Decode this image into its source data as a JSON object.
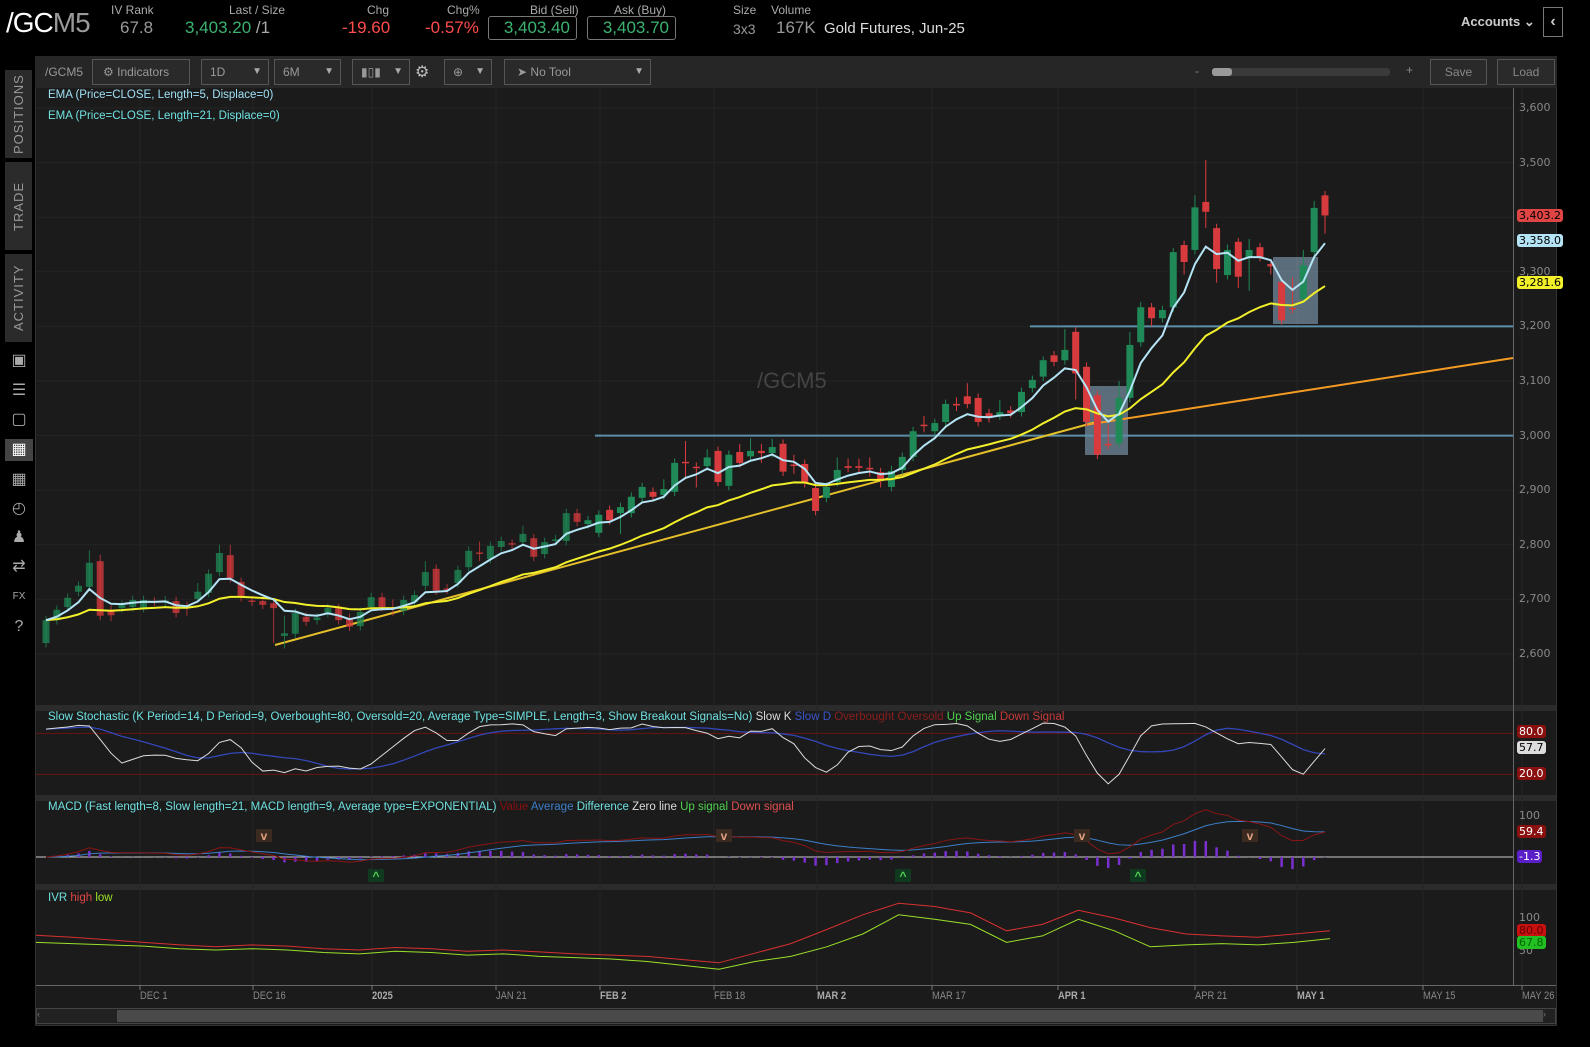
{
  "header": {
    "symbol_main": "/GC",
    "symbol_suffix": "M5",
    "iv_rank_label": "IV Rank",
    "iv_rank": "67.8",
    "last_label": "Last / Size",
    "last": "3,403.20",
    "size": "/1",
    "chg_label": "Chg",
    "chg": "-19.60",
    "chgp_label": "Chg%",
    "chgp": "-0.57%",
    "bid_label": "Bid (Sell)",
    "bid": "3,403.40",
    "ask_label": "Ask (Buy)",
    "ask": "3,403.70",
    "sz_label": "Size",
    "sz": "3x3",
    "vol_label": "Volume",
    "vol": "167K",
    "desc": "Gold Futures, Jun-25",
    "accounts": "Accounts"
  },
  "sidebar": {
    "tabs": [
      "POSITIONS",
      "TRADE",
      "ACTIVITY"
    ],
    "icons": [
      "chart-book-icon",
      "list-icon",
      "tv-icon",
      "chart-grid-icon",
      "layout-icon",
      "history-icon",
      "community-icon",
      "exchange-icon",
      "fx-icon",
      "help-icon"
    ]
  },
  "toolbar": {
    "symbol": "/GCM5",
    "indicators": "Indicators",
    "aggregation": "1D",
    "period": "6M",
    "drawing_tool": "No Tool",
    "zoom_minus": "-",
    "zoom_plus": "+",
    "zoom_level": 0.1,
    "save": "Save",
    "load": "Load"
  },
  "colors": {
    "up": "#1f8a57",
    "down": "#d83b3e",
    "ema5": "#b4e4f5",
    "ema21": "#f2f02a",
    "support": "#5d8fa8",
    "trendline_yellow": "#e6c02a",
    "trendline_orange": "#f59a23",
    "highlight": "#8fb0c8",
    "accent_red": "#ff4d4d",
    "accent_green": "#3cb371"
  },
  "main": {
    "watermark": "/GCM5",
    "studies": [
      "EMA (Price=CLOSE, Length=5, Displace=0)",
      "EMA (Price=CLOSE, Length=21, Displace=0)"
    ],
    "price_labels": [
      "3,600",
      "3,500",
      "3,400",
      "3,300",
      "3,200",
      "3,100",
      "3,000",
      "2,900",
      "2,800",
      "2,700",
      "2,600"
    ],
    "tag_last": "3,403.2",
    "tag_ema5": "3,358.0",
    "tag_ema21": "3,281.6"
  },
  "stoch": {
    "title": "Slow Stochastic (K Period=14, D Period=9, Overbought=80, Oversold=20, Average Type=SIMPLE, Length=3, Show Breakout Signals=No)",
    "legend": [
      "Slow K",
      "Slow D",
      "Overbought",
      "Oversold",
      "Up Signal",
      "Down Signal"
    ],
    "tag_ob": "80.0",
    "tag_k": "57.7",
    "tag_os": "20.0"
  },
  "macd": {
    "title": "MACD (Fast length=8, Slow length=21, MACD length=9, Average type=EXPONENTIAL)",
    "legend": [
      "Value",
      "Average",
      "Difference",
      "Zero line",
      "Up signal",
      "Down signal"
    ],
    "axis": "100",
    "tag_value": "59.4",
    "tag_diff": "-1.3"
  },
  "ivr": {
    "title": "IVR",
    "legend": [
      "high",
      "low"
    ],
    "axis_top": "100",
    "axis_bottom": "50",
    "tag_high": "80.0",
    "tag_low": "67.8"
  },
  "xaxis": [
    "DEC 1",
    "DEC 16",
    "2025",
    "JAN 21",
    "FEB 2",
    "FEB 18",
    "MAR 2",
    "MAR 17",
    "APR 1",
    "APR 21",
    "MAY 1",
    "MAY 15",
    "MAY 26"
  ],
  "chart_data": {
    "type": "candlestick",
    "symbol": "/GCM5",
    "ylim": [
      2550,
      3650
    ],
    "yticks": [
      2600,
      2700,
      2800,
      2900,
      3000,
      3100,
      3200,
      3300,
      3400,
      3500,
      3600
    ],
    "horizontal_levels": [
      3000,
      3200
    ],
    "ohlc": [
      [
        2620,
        2670,
        2612,
        2662
      ],
      [
        2662,
        2689,
        2654,
        2681
      ],
      [
        2686,
        2711,
        2678,
        2703
      ],
      [
        2714,
        2733,
        2706,
        2725
      ],
      [
        2723,
        2790,
        2715,
        2767
      ],
      [
        2770,
        2782,
        2662,
        2670
      ],
      [
        2681,
        2689,
        2660,
        2671
      ],
      [
        2684,
        2698,
        2676,
        2690
      ],
      [
        2686,
        2707,
        2678,
        2699
      ],
      [
        2684,
        2707,
        2676,
        2699
      ],
      [
        2697,
        2704,
        2688,
        2695
      ],
      [
        2694,
        2706,
        2686,
        2698
      ],
      [
        2697,
        2705,
        2667,
        2675
      ],
      [
        2688,
        2696,
        2670,
        2684
      ],
      [
        2701,
        2730,
        2693,
        2714
      ],
      [
        2712,
        2755,
        2704,
        2747
      ],
      [
        2750,
        2800,
        2742,
        2785
      ],
      [
        2781,
        2800,
        2731,
        2739
      ],
      [
        2732,
        2740,
        2696,
        2704
      ],
      [
        2698,
        2706,
        2688,
        2696
      ],
      [
        2697,
        2705,
        2682,
        2690
      ],
      [
        2693,
        2701,
        2620,
        2684
      ],
      [
        2633,
        2670,
        2610,
        2638
      ],
      [
        2637,
        2683,
        2629,
        2675
      ],
      [
        2668,
        2676,
        2651,
        2659
      ],
      [
        2662,
        2675,
        2654,
        2667
      ],
      [
        2675,
        2692,
        2667,
        2684
      ],
      [
        2684,
        2692,
        2654,
        2662
      ],
      [
        2666,
        2674,
        2642,
        2650
      ],
      [
        2651,
        2685,
        2643,
        2677
      ],
      [
        2686,
        2712,
        2678,
        2704
      ],
      [
        2704,
        2712,
        2678,
        2686
      ],
      [
        2685,
        2700,
        2670,
        2684
      ],
      [
        2679,
        2707,
        2671,
        2699
      ],
      [
        2695,
        2716,
        2687,
        2708
      ],
      [
        2725,
        2770,
        2717,
        2750
      ],
      [
        2756,
        2764,
        2708,
        2716
      ],
      [
        2720,
        2728,
        2710,
        2718
      ],
      [
        2730,
        2762,
        2722,
        2754
      ],
      [
        2759,
        2797,
        2751,
        2789
      ],
      [
        2786,
        2806,
        2770,
        2785
      ],
      [
        2774,
        2806,
        2766,
        2798
      ],
      [
        2796,
        2815,
        2788,
        2807
      ],
      [
        2803,
        2810,
        2790,
        2802
      ],
      [
        2805,
        2835,
        2797,
        2820
      ],
      [
        2812,
        2820,
        2770,
        2778
      ],
      [
        2783,
        2813,
        2775,
        2805
      ],
      [
        2807,
        2818,
        2799,
        2810
      ],
      [
        2807,
        2866,
        2799,
        2858
      ],
      [
        2858,
        2866,
        2834,
        2842
      ],
      [
        2838,
        2853,
        2830,
        2845
      ],
      [
        2822,
        2863,
        2814,
        2855
      ],
      [
        2864,
        2872,
        2837,
        2845
      ],
      [
        2858,
        2877,
        2820,
        2869
      ],
      [
        2858,
        2896,
        2850,
        2888
      ],
      [
        2886,
        2914,
        2878,
        2906
      ],
      [
        2897,
        2905,
        2880,
        2888
      ],
      [
        2891,
        2920,
        2883,
        2902
      ],
      [
        2897,
        2958,
        2889,
        2950
      ],
      [
        2952,
        2990,
        2920,
        2950
      ],
      [
        2943,
        2951,
        2905,
        2942
      ],
      [
        2944,
        2975,
        2936,
        2960
      ],
      [
        2972,
        2980,
        2907,
        2915
      ],
      [
        2908,
        2973,
        2900,
        2965
      ],
      [
        2970,
        2985,
        2942,
        2950
      ],
      [
        2962,
        2995,
        2954,
        2972
      ],
      [
        2972,
        2985,
        2950,
        2968
      ],
      [
        2968,
        2994,
        2960,
        2979
      ],
      [
        2985,
        2993,
        2926,
        2934
      ],
      [
        2947,
        2965,
        2930,
        2946
      ],
      [
        2948,
        2956,
        2905,
        2913
      ],
      [
        2904,
        2912,
        2854,
        2862
      ],
      [
        2886,
        2914,
        2878,
        2906
      ],
      [
        2915,
        2960,
        2907,
        2937
      ],
      [
        2944,
        2958,
        2933,
        2941
      ],
      [
        2944,
        2958,
        2933,
        2941
      ],
      [
        2941,
        2960,
        2925,
        2940
      ],
      [
        2933,
        2941,
        2905,
        2919
      ],
      [
        2906,
        2945,
        2898,
        2935
      ],
      [
        2937,
        2969,
        2929,
        2961
      ],
      [
        2961,
        3016,
        2953,
        3008
      ],
      [
        3020,
        3036,
        3006,
        3018
      ],
      [
        3008,
        3031,
        3000,
        3023
      ],
      [
        3025,
        3066,
        3017,
        3058
      ],
      [
        3058,
        3070,
        3045,
        3057
      ],
      [
        3072,
        3096,
        3050,
        3058
      ],
      [
        3069,
        3077,
        3017,
        3025
      ],
      [
        3041,
        3049,
        3024,
        3032
      ],
      [
        3037,
        3065,
        3029,
        3043
      ],
      [
        3046,
        3054,
        3033,
        3041
      ],
      [
        3043,
        3088,
        3035,
        3080
      ],
      [
        3087,
        3110,
        3079,
        3102
      ],
      [
        3108,
        3145,
        3100,
        3138
      ],
      [
        3147,
        3155,
        3127,
        3135
      ],
      [
        3138,
        3195,
        3130,
        3157
      ],
      [
        3190,
        3198,
        3066,
        3114
      ],
      [
        3126,
        3134,
        3017,
        3025
      ],
      [
        3074,
        3082,
        2957,
        2965
      ],
      [
        2985,
        3020,
        2975,
        2982
      ],
      [
        2986,
        3100,
        2978,
        3069
      ],
      [
        3069,
        3190,
        3061,
        3166
      ],
      [
        3171,
        3245,
        3163,
        3235
      ],
      [
        3235,
        3243,
        3200,
        3215
      ],
      [
        3215,
        3238,
        3207,
        3230
      ],
      [
        3235,
        3344,
        3227,
        3336
      ],
      [
        3349,
        3357,
        3295,
        3318
      ],
      [
        3340,
        3440,
        3332,
        3418
      ],
      [
        3428,
        3505,
        3380,
        3410
      ],
      [
        3380,
        3388,
        3280,
        3305
      ],
      [
        3294,
        3350,
        3286,
        3340
      ],
      [
        3355,
        3362,
        3270,
        3291
      ],
      [
        3327,
        3360,
        3265,
        3340
      ],
      [
        3345,
        3353,
        3319,
        3327
      ],
      [
        3314,
        3322,
        3295,
        3310
      ],
      [
        3281,
        3289,
        3203,
        3211
      ],
      [
        3234,
        3290,
        3224,
        3232
      ],
      [
        3250,
        3340,
        3242,
        3312
      ],
      [
        3336,
        3430,
        3328,
        3417
      ],
      [
        3440,
        3448,
        3370,
        3403.2
      ]
    ],
    "ivr_high": [
      73,
      70,
      66,
      62,
      58,
      55,
      58,
      56,
      52,
      50,
      54,
      52,
      48,
      50,
      47,
      44,
      42,
      40,
      35,
      30,
      45,
      60,
      82,
      105,
      123,
      118,
      108,
      80,
      90,
      112,
      100,
      85,
      75,
      72,
      70,
      75,
      80
    ],
    "ivr_low": [
      62,
      60,
      58,
      56,
      52,
      50,
      52,
      50,
      46,
      44,
      48,
      46,
      42,
      44,
      40,
      38,
      36,
      32,
      26,
      20,
      32,
      40,
      55,
      75,
      105,
      98,
      90,
      62,
      72,
      98,
      80,
      55,
      58,
      60,
      58,
      62,
      67.8
    ]
  }
}
